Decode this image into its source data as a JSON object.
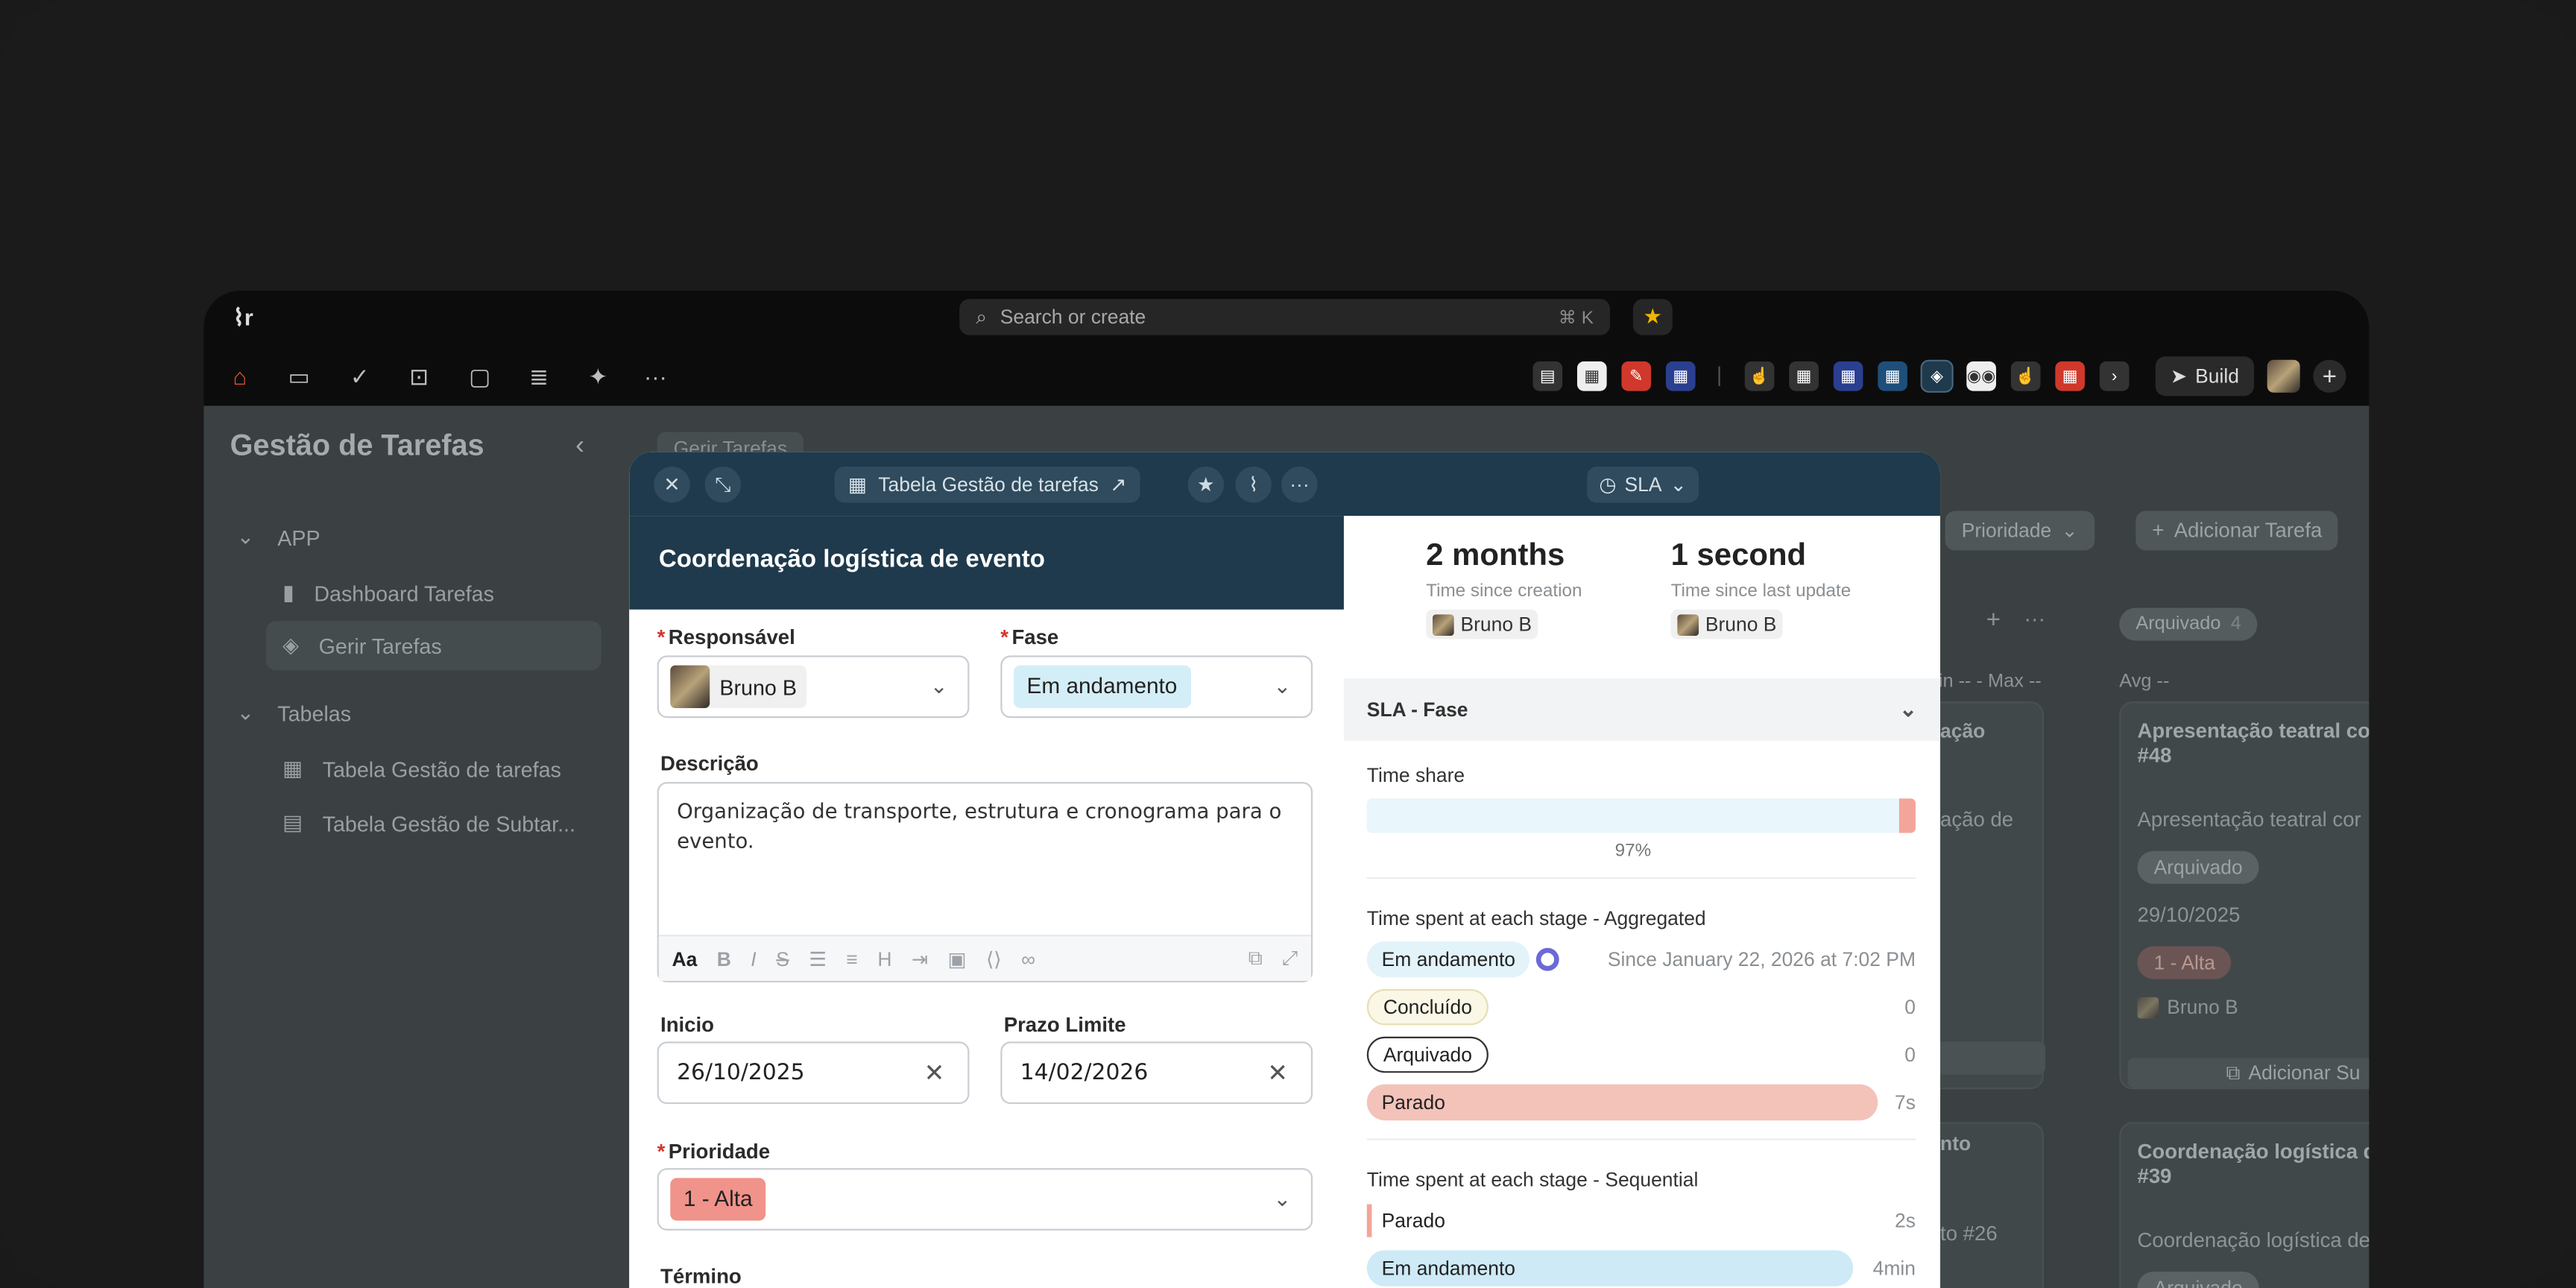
{
  "search": {
    "placeholder": "Search or create",
    "shortcut": "⌘ K"
  },
  "toolbar": {
    "build_label": "Build"
  },
  "sidebar": {
    "title": "Gestão de Tarefas",
    "sections": [
      {
        "label": "APP",
        "items": [
          {
            "label": "Dashboard Tarefas"
          },
          {
            "label": "Gerir Tarefas"
          }
        ]
      },
      {
        "label": "Tabelas",
        "items": [
          {
            "label": "Tabela Gestão de tarefas"
          },
          {
            "label": "Tabela Gestão de Subtar..."
          }
        ]
      }
    ]
  },
  "main": {
    "breadcrumb": "Gerir Tarefas",
    "priority_button": "Prioridade",
    "add_task_button": "Adicionar Tarefa",
    "column_archived": {
      "label": "Arquivado",
      "count": "4",
      "avg": "Avg --"
    },
    "column_minmax": "in -- - Max --",
    "card1": {
      "title": "Apresentação teatral cor",
      "title2": "#48",
      "desc": "Apresentação teatral cor",
      "status": "Arquivado",
      "date": "29/10/2025",
      "priority": "1 - Alta",
      "user": "Bruno B",
      "add_sub": "Adicionar Su"
    },
    "card2": {
      "title": "Coordenação logística d",
      "title2": "#39",
      "desc": "Coordenação logística de",
      "status": "Arquivado"
    },
    "partial1": "ação",
    "partial2": "ação de",
    "partial3": "nto",
    "partial4": "to #26"
  },
  "modal": {
    "table_link": "Tabela Gestão de tarefas",
    "sla_label": "SLA",
    "title": "Coordenação logística de evento",
    "responsavel": {
      "label": "Responsável",
      "value": "Bruno B"
    },
    "fase": {
      "label": "Fase",
      "value": "Em andamento"
    },
    "descricao": {
      "label": "Descrição",
      "value": "Organização de transporte, estrutura e cronograma para o evento."
    },
    "editor": {
      "font_button": "Aa"
    },
    "inicio": {
      "label": "Inicio",
      "value": "26/10/2025"
    },
    "prazo": {
      "label": "Prazo Limite",
      "value": "14/02/2026"
    },
    "prioridade": {
      "label": "Prioridade",
      "value": "1 - Alta"
    },
    "termino": {
      "label": "Término"
    },
    "sla": {
      "since_creation": {
        "value": "2 months",
        "caption": "Time since creation",
        "user": "Bruno B"
      },
      "since_update": {
        "value": "1 second",
        "caption": "Time since last update",
        "user": "Bruno B"
      },
      "section": "SLA - Fase",
      "time_share": {
        "label": "Time share",
        "percent_label": "97%",
        "fraction": 0.97
      },
      "aggregated": {
        "title": "Time spent at each stage - Aggregated",
        "rows": [
          {
            "stage": "Em andamento",
            "value": "Since January 22, 2026 at 7:02 PM",
            "color": "#e3f3fa"
          },
          {
            "stage": "Concluído",
            "value": "0",
            "color": "#fbf7e6"
          },
          {
            "stage": "Arquivado",
            "value": "0",
            "color": "#ffffff"
          },
          {
            "stage": "Parado",
            "value": "7s",
            "color": "#f3c3b9"
          }
        ]
      },
      "sequential": {
        "title": "Time spent at each stage - Sequential",
        "rows": [
          {
            "stage": "Parado",
            "value": "2s",
            "color": "#f3c3b9"
          },
          {
            "stage": "Em andamento",
            "value": "4min",
            "color": "#cdeaf6"
          }
        ]
      }
    }
  },
  "colors": {
    "accent": "#1e3a4c",
    "home": "#e8552f",
    "star": "#f1b500",
    "alta": "#f0938a",
    "em_andamento": "#d4eef8"
  }
}
